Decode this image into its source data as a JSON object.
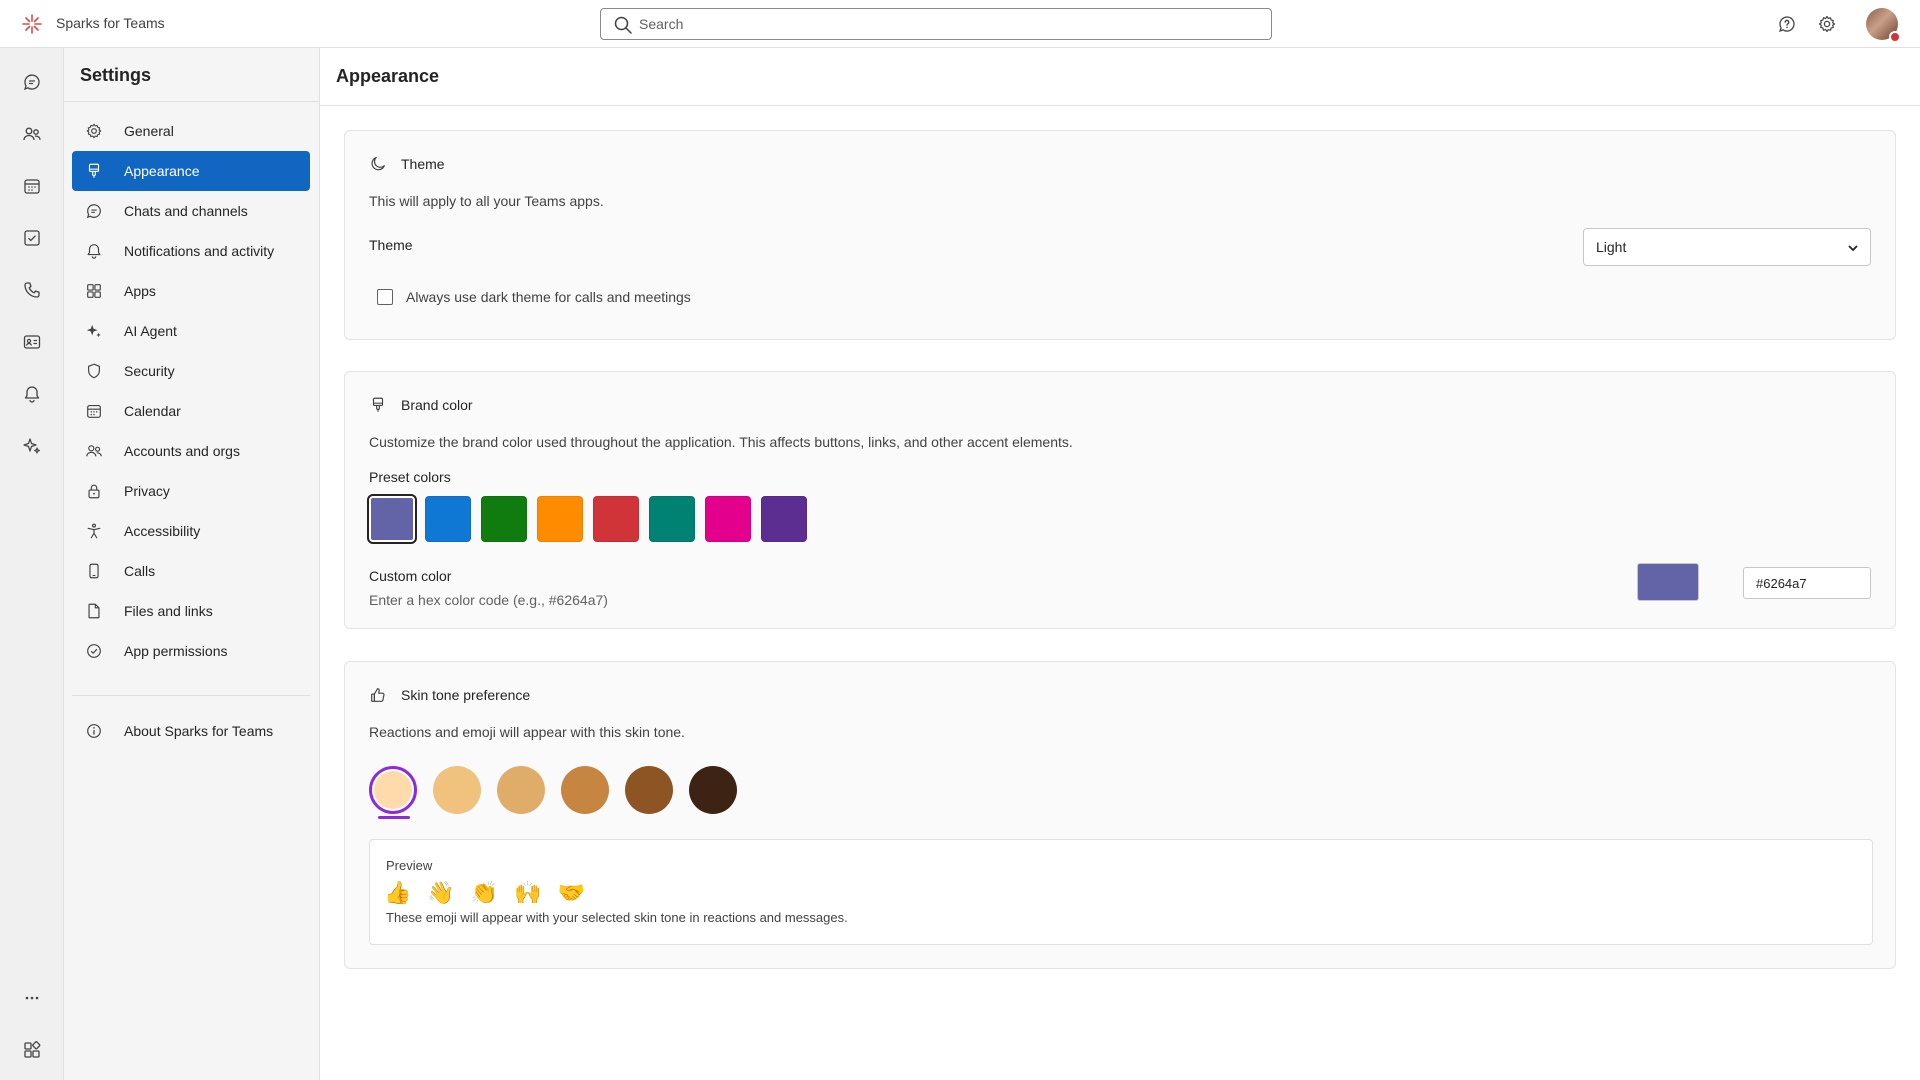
{
  "app": {
    "title": "Sparks for Teams"
  },
  "search": {
    "placeholder": "Search"
  },
  "sidebar": {
    "title": "Settings",
    "items": [
      {
        "label": "General",
        "icon": "gear-icon"
      },
      {
        "label": "Appearance",
        "icon": "paintbrush-icon",
        "active": true
      },
      {
        "label": "Chats and channels",
        "icon": "chat-icon"
      },
      {
        "label": "Notifications and activity",
        "icon": "bell-icon"
      },
      {
        "label": "Apps",
        "icon": "apps-icon"
      },
      {
        "label": "AI Agent",
        "icon": "sparkle-icon"
      },
      {
        "label": "Security",
        "icon": "shield-icon"
      },
      {
        "label": "Calendar",
        "icon": "calendar-icon"
      },
      {
        "label": "Accounts and orgs",
        "icon": "people-icon"
      },
      {
        "label": "Privacy",
        "icon": "lock-icon"
      },
      {
        "label": "Accessibility",
        "icon": "accessibility-icon"
      },
      {
        "label": "Calls",
        "icon": "phone-icon"
      },
      {
        "label": "Files and links",
        "icon": "file-icon"
      },
      {
        "label": "App permissions",
        "icon": "check-circle-icon"
      }
    ],
    "about": {
      "label": "About Sparks for Teams",
      "icon": "info-icon"
    }
  },
  "main": {
    "title": "Appearance",
    "theme": {
      "heading": "Theme",
      "description": "This will apply to all your Teams apps.",
      "label": "Theme",
      "selected": "Light",
      "dark_calls_label": "Always use dark theme for calls and meetings",
      "dark_calls_checked": false
    },
    "brand": {
      "heading": "Brand color",
      "description": "Customize the brand color used throughout the application. This affects buttons, links, and other accent elements.",
      "preset_label": "Preset colors",
      "presets": [
        "#6264a7",
        "#0f78d4",
        "#107c10",
        "#ff8c00",
        "#d13438",
        "#008272",
        "#e3008c",
        "#5c2e91"
      ],
      "selected_preset": 0,
      "custom_label": "Custom color",
      "custom_hint": "Enter a hex color code (e.g., #6264a7)",
      "custom_value": "#6264a7"
    },
    "skin": {
      "heading": "Skin tone preference",
      "description": "Reactions and emoji will appear with this skin tone.",
      "tones": [
        "#ffdbac",
        "#f1c27d",
        "#e0ac69",
        "#c68642",
        "#8d5524",
        "#3d2314"
      ],
      "selected_tone": 0,
      "preview_label": "Preview",
      "preview_emoji": [
        "👍",
        "👋",
        "👏",
        "🙌",
        "🤝"
      ],
      "preview_desc": "These emoji will appear with your selected skin tone in reactions and messages."
    }
  },
  "colors": {
    "accent": "#1166c2",
    "selection_ring": "#8a2be2",
    "brand": "#6264a7"
  }
}
